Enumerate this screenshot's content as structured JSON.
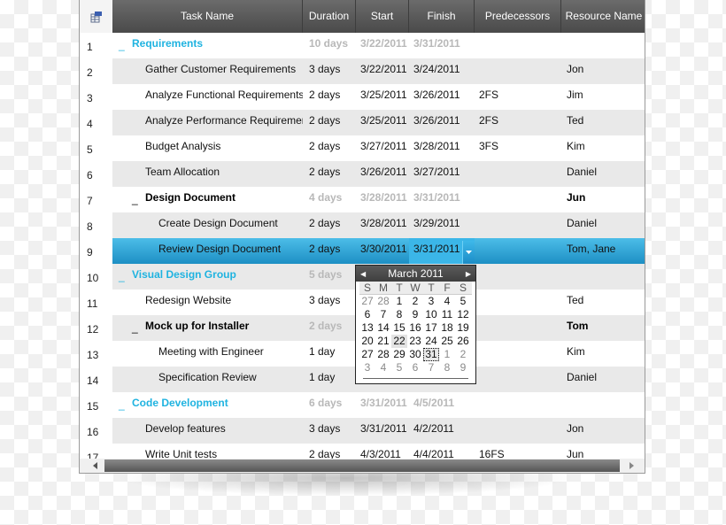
{
  "header": {
    "columns": [
      "Task Name",
      "Duration",
      "Start",
      "Finish",
      "Predecessors",
      "Resource Name"
    ]
  },
  "rows": [
    {
      "num": "1",
      "name": "Requirements",
      "duration": "10 days",
      "start": "3/22/2011",
      "finish": "3/31/2011",
      "pred": "",
      "res": "",
      "type": "summary-teal",
      "indent": 0
    },
    {
      "num": "2",
      "name": "Gather Customer Requirements",
      "duration": "3 days",
      "start": "3/22/2011",
      "finish": "3/24/2011",
      "pred": "",
      "res": "Jon",
      "type": "task",
      "indent": 1
    },
    {
      "num": "3",
      "name": "Analyze Functional Requirements",
      "duration": "2 days",
      "start": "3/25/2011",
      "finish": "3/26/2011",
      "pred": "2FS",
      "res": "Jim",
      "type": "task",
      "indent": 1
    },
    {
      "num": "4",
      "name": "Analyze Performance Requirement",
      "duration": "2 days",
      "start": "3/25/2011",
      "finish": "3/26/2011",
      "pred": "2FS",
      "res": "Ted",
      "type": "task",
      "indent": 1
    },
    {
      "num": "5",
      "name": "Budget Analysis",
      "duration": "2 days",
      "start": "3/27/2011",
      "finish": "3/28/2011",
      "pred": "3FS",
      "res": "Kim",
      "type": "task",
      "indent": 1
    },
    {
      "num": "6",
      "name": "Team Allocation",
      "duration": "2 days",
      "start": "3/26/2011",
      "finish": "3/27/2011",
      "pred": "",
      "res": "Daniel",
      "type": "task",
      "indent": 1
    },
    {
      "num": "7",
      "name": "Design Document",
      "duration": "4 days",
      "start": "3/28/2011",
      "finish": "3/31/2011",
      "pred": "",
      "res": "Jun",
      "type": "summary-bold",
      "indent": 1
    },
    {
      "num": "8",
      "name": "Create Design Document",
      "duration": "2 days",
      "start": "3/28/2011",
      "finish": "3/29/2011",
      "pred": "",
      "res": "Daniel",
      "type": "task",
      "indent": 2
    },
    {
      "num": "9",
      "name": "Review Design Document",
      "duration": "2 days",
      "start": "3/30/2011",
      "finish": "3/31/2011",
      "pred": "",
      "res": "Tom, Jane",
      "type": "task",
      "indent": 2,
      "selected": true
    },
    {
      "num": "10",
      "name": "Visual Design Group",
      "duration": "5 days",
      "start": "",
      "finish": "",
      "pred": "",
      "res": "",
      "type": "summary-teal",
      "indent": 0
    },
    {
      "num": "11",
      "name": "Redesign Website",
      "duration": "3 days",
      "start": "",
      "finish": "",
      "pred": "",
      "res": "Ted",
      "type": "task",
      "indent": 1
    },
    {
      "num": "12",
      "name": "Mock up for Installer",
      "duration": "2 days",
      "start": "",
      "finish": "",
      "pred": "",
      "res": "Tom",
      "type": "summary-bold",
      "indent": 1
    },
    {
      "num": "13",
      "name": "Meeting with Engineer",
      "duration": "1 day",
      "start": "",
      "finish": "",
      "pred": "",
      "res": "Kim",
      "type": "task",
      "indent": 2
    },
    {
      "num": "14",
      "name": "Specification Review",
      "duration": "1 day",
      "start": "",
      "finish": "",
      "pred": "",
      "res": "Daniel",
      "type": "task",
      "indent": 2
    },
    {
      "num": "15",
      "name": "Code Development",
      "duration": "6 days",
      "start": "3/31/2011",
      "finish": "4/5/2011",
      "pred": "",
      "res": "",
      "type": "summary-teal",
      "indent": 0
    },
    {
      "num": "16",
      "name": "Develop features",
      "duration": "3 days",
      "start": "3/31/2011",
      "finish": "4/2/2011",
      "pred": "",
      "res": "Jon",
      "type": "task",
      "indent": 1
    },
    {
      "num": "17",
      "name": "Write Unit tests",
      "duration": "2 days",
      "start": "4/3/2011",
      "finish": "4/4/2011",
      "pred": "16FS",
      "res": "Jun",
      "type": "task",
      "indent": 1
    }
  ],
  "toggle_symbol": "_",
  "calendar": {
    "title": "March 2011",
    "prev_icon": "◀",
    "next_icon": "▶",
    "days_of_week": [
      "S",
      "M",
      "T",
      "W",
      "T",
      "F",
      "S"
    ],
    "weeks": [
      [
        [
          "27",
          "other"
        ],
        [
          "28",
          "other"
        ],
        [
          "1",
          ""
        ],
        [
          "2",
          ""
        ],
        [
          "3",
          ""
        ],
        [
          "4",
          ""
        ],
        [
          "5",
          ""
        ]
      ],
      [
        [
          "6",
          ""
        ],
        [
          "7",
          ""
        ],
        [
          "8",
          ""
        ],
        [
          "9",
          ""
        ],
        [
          "10",
          ""
        ],
        [
          "11",
          ""
        ],
        [
          "12",
          ""
        ]
      ],
      [
        [
          "13",
          ""
        ],
        [
          "14",
          ""
        ],
        [
          "15",
          ""
        ],
        [
          "16",
          ""
        ],
        [
          "17",
          ""
        ],
        [
          "18",
          ""
        ],
        [
          "19",
          ""
        ]
      ],
      [
        [
          "20",
          ""
        ],
        [
          "21",
          ""
        ],
        [
          "22",
          "today"
        ],
        [
          "23",
          ""
        ],
        [
          "24",
          ""
        ],
        [
          "25",
          ""
        ],
        [
          "26",
          ""
        ]
      ],
      [
        [
          "27",
          ""
        ],
        [
          "28",
          ""
        ],
        [
          "29",
          ""
        ],
        [
          "30",
          ""
        ],
        [
          "31",
          "sel"
        ],
        [
          "1",
          "other"
        ],
        [
          "2",
          "other"
        ]
      ],
      [
        [
          "3",
          "other"
        ],
        [
          "4",
          "other"
        ],
        [
          "5",
          "other"
        ],
        [
          "6",
          "other"
        ],
        [
          "7",
          "other"
        ],
        [
          "8",
          "other"
        ],
        [
          "9",
          "other"
        ]
      ]
    ]
  },
  "editor": {
    "value": "3/31/2011"
  }
}
